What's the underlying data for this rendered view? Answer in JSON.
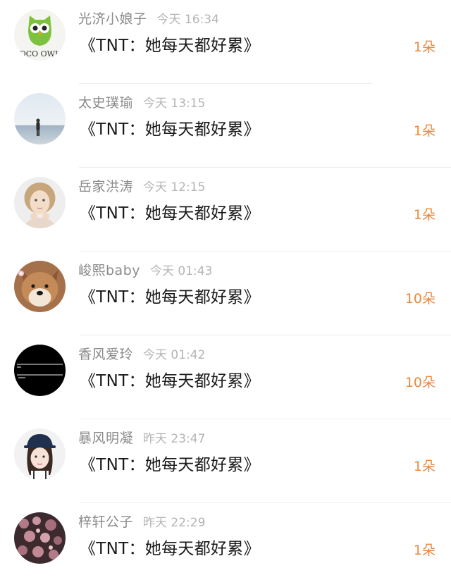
{
  "items": [
    {
      "name": "光济小娘子",
      "time": "今天 16:34",
      "title": "《TNT：她每天都好累》",
      "count": "1朵",
      "avatar": "owl-logo-avatar",
      "avatar_text": "OCO OWL"
    },
    {
      "name": "太史璞瑜",
      "time": "今天 13:15",
      "title": "《TNT：她每天都好累》",
      "count": "1朵",
      "avatar": "seaside-figure-avatar"
    },
    {
      "name": "岳家洪涛",
      "time": "今天 12:15",
      "title": "《TNT：她每天都好累》",
      "count": "1朵",
      "avatar": "child-portrait-avatar"
    },
    {
      "name": "峻熙baby",
      "time": "今天 01:43",
      "title": "《TNT：她每天都好累》",
      "count": "10朵",
      "avatar": "shiba-dog-avatar"
    },
    {
      "name": "香风爱玲",
      "time": "今天 01:42",
      "title": "《TNT：她每天都好累》",
      "count": "10朵",
      "avatar": "black-text-avatar"
    },
    {
      "name": "暴风明凝",
      "time": "昨天 23:47",
      "title": "《TNT：她每天都好累》",
      "count": "1朵",
      "avatar": "girl-cap-avatar"
    },
    {
      "name": "梓轩公子",
      "time": "昨天 22:29",
      "title": "《TNT：她每天都好累》",
      "count": "1朵",
      "avatar": "pink-flowers-avatar"
    }
  ],
  "colors": {
    "name": "#8a8a8a",
    "time": "#b4b4b4",
    "title": "#1a1a1a",
    "count": "#e8883e",
    "divider": "#eeeeee"
  }
}
